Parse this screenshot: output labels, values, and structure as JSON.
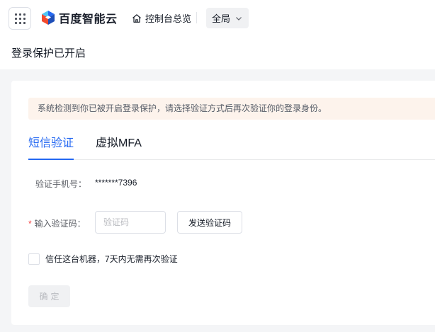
{
  "header": {
    "logo_text": "百度智能云",
    "home_label": "控制台总览",
    "scope_label": "全局",
    "icons": {
      "menu": "grid-menu-icon",
      "home": "home-icon",
      "chevron": "chevron-down-icon",
      "logo": "baidu-cloud-logo-icon"
    }
  },
  "page": {
    "title": "登录保护已开启",
    "notice": "系统检测到你已被开启登录保护，请选择验证方式后再次验证你的登录身份。"
  },
  "tabs": [
    {
      "label": "短信验证",
      "active": true
    },
    {
      "label": "虚拟MFA",
      "active": false
    }
  ],
  "form": {
    "phone_label": "验证手机号：",
    "phone_value": "*******7396",
    "required_mark": "*",
    "code_label": "输入验证码：",
    "code_placeholder": "验证码",
    "code_value": "",
    "send_button": "发送验证码",
    "trust_label": "信任这台机器，7天内无需再次验证",
    "trust_checked": false,
    "confirm_button": "确定"
  },
  "colors": {
    "accent": "#2468f2",
    "notice_bg": "#fdf3ec",
    "required": "#f33e3e",
    "page_bg": "#f4f5f7"
  }
}
